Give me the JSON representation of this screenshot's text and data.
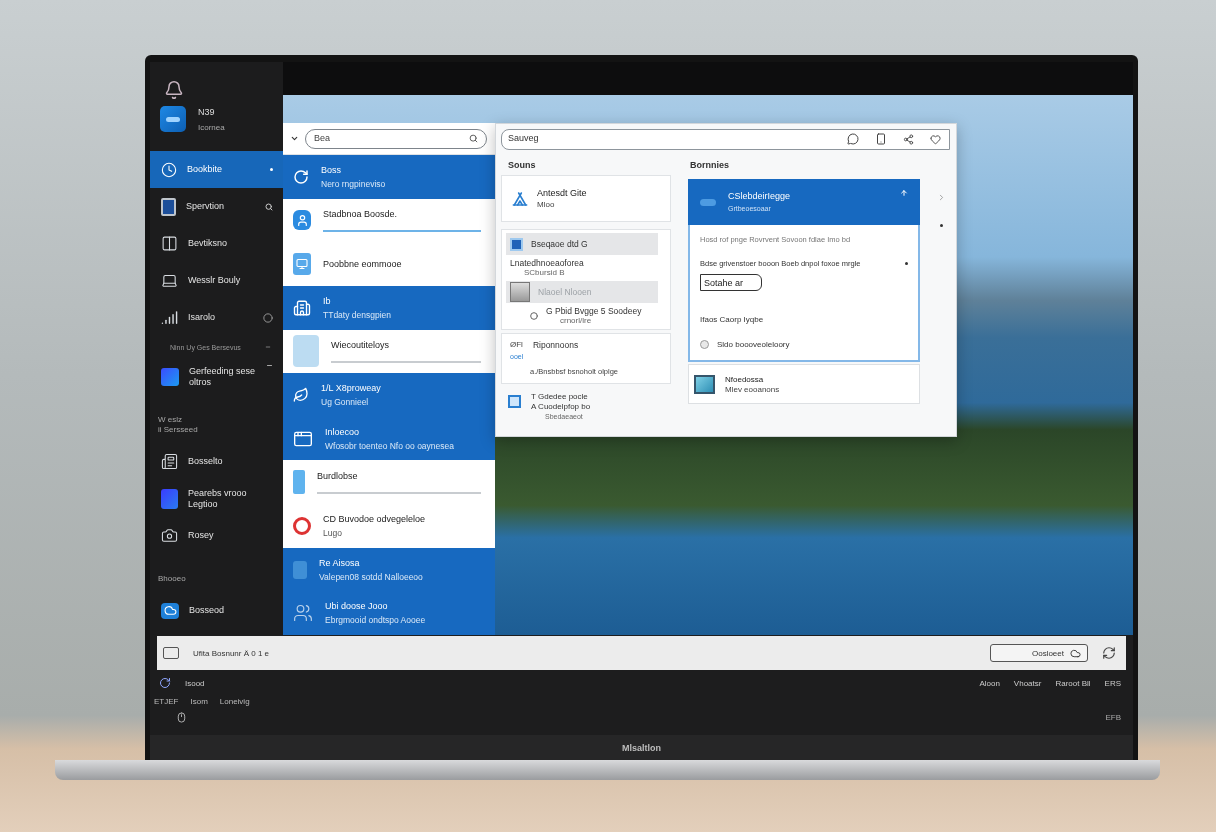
{
  "screen": {
    "sidebar": {
      "app_name": "N39",
      "app_subtitle": "Icornea",
      "entries": [
        {
          "kind": "item",
          "label": "Bookbite",
          "selected": true
        },
        {
          "kind": "item",
          "label": "Spervtion",
          "selected": false
        },
        {
          "kind": "item",
          "label": "Bevtiksno",
          "selected": false
        },
        {
          "kind": "item",
          "label": "Wesslr Bouly",
          "selected": false
        },
        {
          "kind": "item",
          "label": "Isarolo",
          "selected": false
        },
        {
          "kind": "note",
          "label": "Ninn  Uy Ges Bersevus"
        },
        {
          "kind": "item",
          "label": "Gerfeeding sese\noltros",
          "selected": false
        },
        {
          "kind": "heading",
          "label": "W eslz\nii Sersseed"
        },
        {
          "kind": "item",
          "label": "Bosselto",
          "selected": false
        },
        {
          "kind": "item",
          "label": "Pearebs vrooo\nLegtioo",
          "selected": false
        },
        {
          "kind": "item",
          "label": "Rosey",
          "selected": false
        },
        {
          "kind": "heading",
          "label": "Bhooeo"
        },
        {
          "kind": "item",
          "label": "Bosseod",
          "selected": false
        }
      ]
    },
    "list_panel": {
      "search": {
        "value": "Bea"
      },
      "items": [
        {
          "title": "Boss",
          "subtitle": "Nero rngpineviso",
          "selected": true,
          "underlined": false
        },
        {
          "title": "Stadbnoa Boosde.",
          "selected": false,
          "underlined": true,
          "color": "#6db3e8"
        },
        {
          "title": "Poobbne eommooe",
          "selected": false,
          "underlined": false
        },
        {
          "title": "Ib",
          "subtitle": "TTdaty densgpien",
          "selected": true,
          "underlined": false
        },
        {
          "title": "Wiecoutiteloys",
          "selected": false,
          "underlined": true,
          "color": "#c8ccd0"
        },
        {
          "title": "1/L X8proweay",
          "subtitle": "Ug Gonnieel",
          "selected": true,
          "underlined": false
        },
        {
          "title": "Inloecoo",
          "subtitle": "Wfosobr toenteo Nfo oo oaynesea",
          "selected": true,
          "underlined": false
        },
        {
          "title": "Burdlobse",
          "selected": false,
          "underlined": true,
          "color": "#c8ccd0"
        },
        {
          "title": "CD Buvodoe odvegeleloe",
          "subtitle": "Lugo",
          "selected": false,
          "underlined": false
        },
        {
          "title": "Re Aisosa",
          "subtitle": "Valepen08 sotdd Nalloeeoo",
          "selected": true,
          "underlined": false
        },
        {
          "title": "Ubi doose Jooo",
          "subtitle": "Ebrgmooid ondtspo Aooee",
          "selected": true,
          "underlined": false
        }
      ]
    },
    "settings_window": {
      "search": {
        "value": "Sauveg"
      },
      "sources": {
        "heading": "Souns",
        "card": {
          "title": "Antesdt Gite",
          "subtitle": "Mloo"
        },
        "rows": [
          {
            "label": "Bseqaoe dtd G",
            "selected": true,
            "disabled": false
          },
          {
            "label": "Lnatedhnoeaoforea",
            "detail": "SCbursid B",
            "selected": false,
            "disabled": false
          },
          {
            "label": "Nlaoel Nlooen",
            "selected": true,
            "disabled": true
          },
          {
            "label": "G Pbid Bvgge 5 Soodeey",
            "detail": "crnorl/lre",
            "selected": false,
            "disabled": false
          }
        ],
        "summary": {
          "code": "ØFl",
          "tag": "ooel",
          "title": "Riponnoons",
          "note": "a./Bnsbbsf bsnoholt olplge"
        },
        "footer": {
          "title": "T Gdedee pocle\nA Cuodelpfop bo",
          "subtitle": "Sbedaeaeot"
        }
      },
      "details": {
        "heading": "Bornnies",
        "header": {
          "title": "CSlebdeirIegge",
          "subtitle": "Grtbeoesoaar"
        },
        "description": "Hosd rof pnge Rovrvent Sovoon fdlae Imo bd",
        "option": "Bdse grivenstoer booon Boeb dnpol foxoe mrgle",
        "button": "Sotahe ar",
        "label": "Ifaos Caorp Iyqbe",
        "radio": {
          "label": "Sldo boooveoleloory",
          "checked": false
        },
        "card": {
          "title": "Nfoedossa",
          "subtitle": "Mlev eooanons"
        }
      }
    },
    "bottom_bar": {
      "status": "Ufita Bosnunr Ä 0 1 e",
      "button": "Oosloeet"
    },
    "taskbar": {
      "app_label": "Isood",
      "tray_items": [
        "Aloon",
        "Vhoatsr",
        "Raroot Bll",
        "ERS"
      ],
      "second_row": [
        "ETJEF",
        "Isom",
        "Loneivig"
      ],
      "corner_label": "EFB"
    }
  },
  "laptop": {
    "brand": "Mlsaltlon"
  }
}
